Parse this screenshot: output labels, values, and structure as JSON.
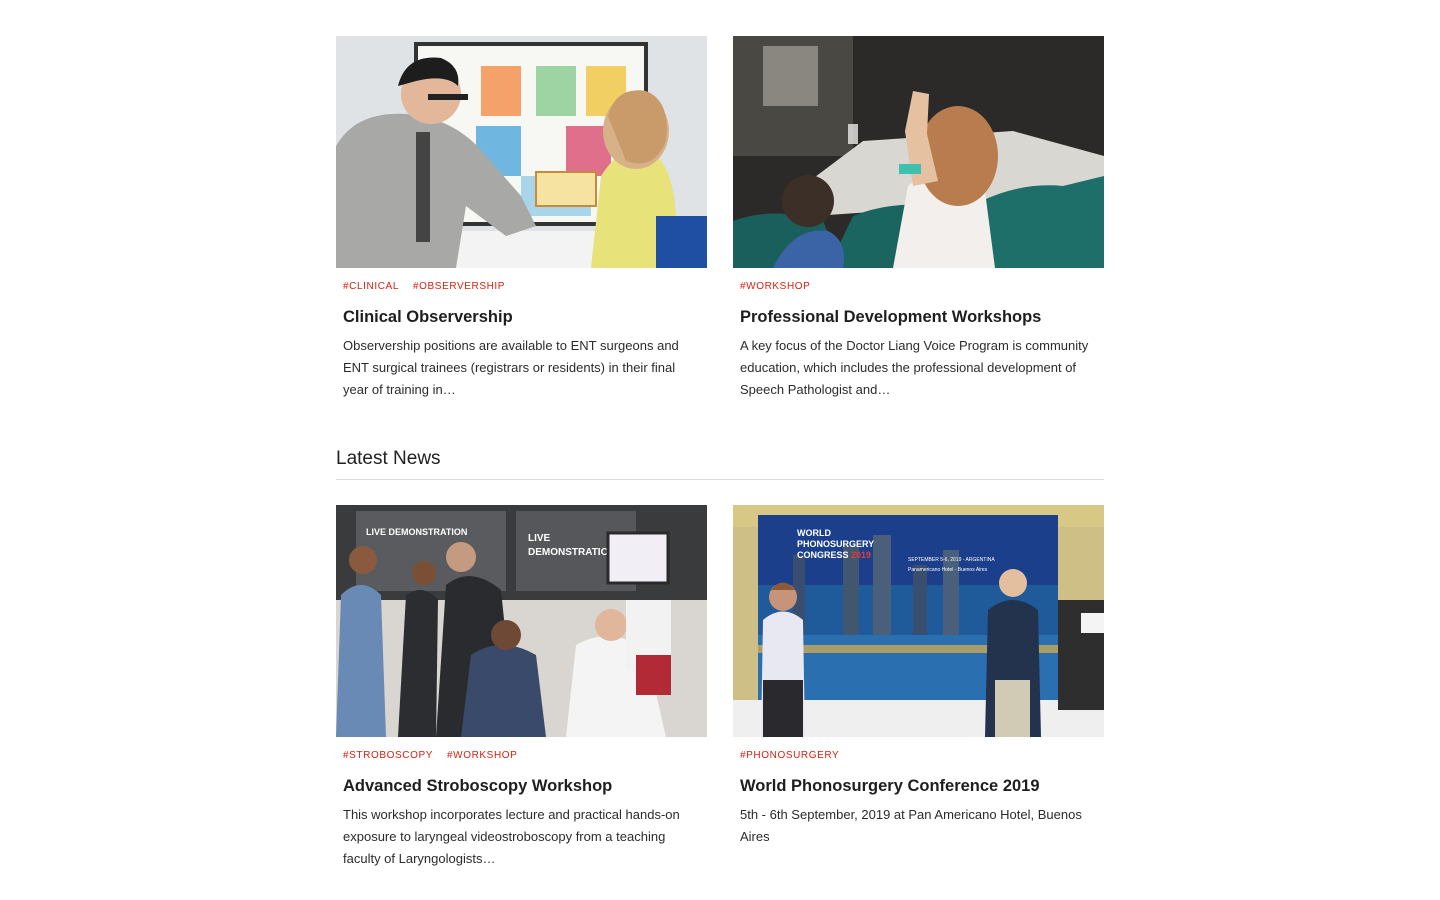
{
  "programs": [
    {
      "tags": [
        "#CLINICAL",
        "#OBSERVERSHIP"
      ],
      "title": "Clinical Observership",
      "excerpt": "Observership positions are available to ENT surgeons and ENT surgical trainees (registrars or residents) in their final year of training in…"
    },
    {
      "tags": [
        "#WORKSHOP"
      ],
      "title": "Professional Development Workshops",
      "excerpt": "A key focus of the Doctor Liang Voice Program is community education, which includes the professional development of Speech Pathologist and…"
    }
  ],
  "latest_news": {
    "heading": "Latest News",
    "items": [
      {
        "tags": [
          "#STROBOSCOPY",
          "#WORKSHOP"
        ],
        "title": "Advanced Stroboscopy Workshop",
        "excerpt": "This workshop incorporates lecture and practical hands-on exposure to laryngeal videostroboscopy from a teaching faculty of Laryngologists…",
        "photo_text": {
          "screen_left": "LIVE DEMONSTRATION",
          "screen_right_line1": "LIVE",
          "screen_right_line2": "DEMONSTRATION"
        }
      },
      {
        "tags": [
          "#PHONOSURGERY"
        ],
        "title": "World Phonosurgery Conference 2019",
        "excerpt": "5th - 6th September, 2019 at Pan Americano Hotel, Buenos Aires",
        "photo_text": {
          "banner_line1": "WORLD",
          "banner_line2": "PHONOSURGERY",
          "banner_line3": "CONGRESS",
          "banner_year": "2019",
          "banner_date": "SEPTEMBER 5-6, 2019 - ARGENTINA",
          "banner_venue": "Panamericano Hotel - Buenos Aires"
        }
      }
    ]
  },
  "colors": {
    "tag": "#d3220f",
    "title": "#1e1e1e",
    "text": "#2b2b2b",
    "divider": "#dcdcdc"
  }
}
